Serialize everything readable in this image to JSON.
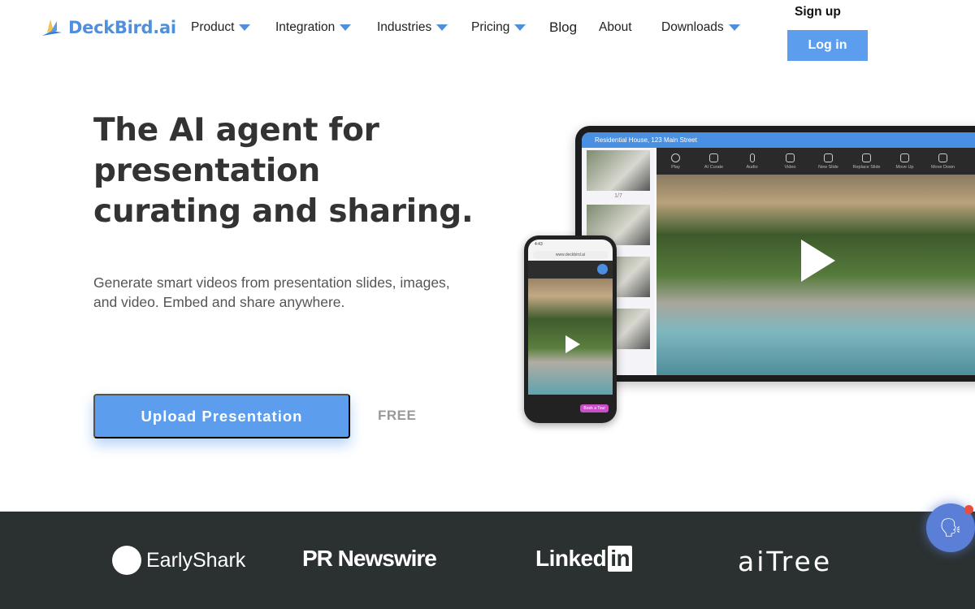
{
  "header": {
    "logo_text": "DeckBird.ai",
    "nav": [
      {
        "label": "Product",
        "dropdown": true
      },
      {
        "label": "Integration",
        "dropdown": true
      },
      {
        "label": "Industries",
        "dropdown": true
      },
      {
        "label": "Pricing",
        "dropdown": true
      },
      {
        "label": "Blog",
        "dropdown": false
      },
      {
        "label": "About",
        "dropdown": false
      },
      {
        "label": "Downloads",
        "dropdown": true
      }
    ],
    "signup": "Sign up",
    "login": "Log in"
  },
  "hero": {
    "title_lines": [
      "The AI agent for",
      "presentation",
      "curating and sharing."
    ],
    "subtitle_lines": [
      "Generate smart videos from presentation slides, images,",
      "and video. Embed and share anywhere."
    ],
    "cta": "Upload Presentation",
    "free": "FREE"
  },
  "tablet": {
    "title": "Residential House, 123 Main Street",
    "tools": [
      "Play",
      "AI Curate",
      "Audio",
      "Video",
      "New Slide",
      "Replace Slide",
      "Move Up",
      "Move Down"
    ],
    "slide_counter": "1/7"
  },
  "phone": {
    "url": "www.deckbird.ai",
    "time": "4:43",
    "book": "Book a Tour"
  },
  "footer": {
    "brands": [
      "EarlyShark",
      "PR Newswire",
      "Linked",
      "in",
      "aiTree"
    ]
  },
  "colors": {
    "accent": "#5c9ded",
    "brand": "#4f8fdc",
    "footer": "#2b3030"
  }
}
